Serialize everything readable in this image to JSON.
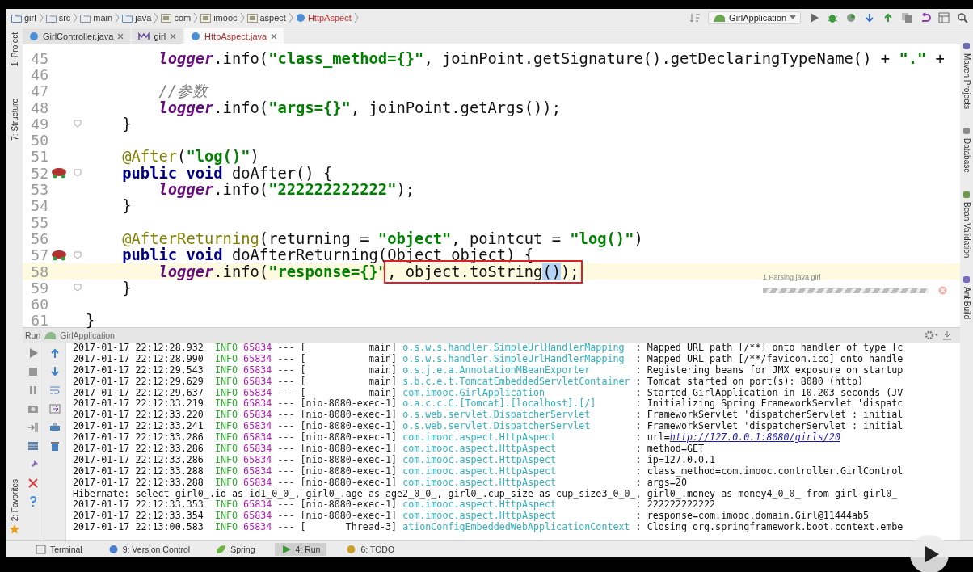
{
  "breadcrumbs": [
    {
      "label": "girl",
      "kind": "module"
    },
    {
      "label": "src",
      "kind": "folder"
    },
    {
      "label": "main",
      "kind": "folder"
    },
    {
      "label": "java",
      "kind": "source"
    },
    {
      "label": "com",
      "kind": "package"
    },
    {
      "label": "imooc",
      "kind": "package"
    },
    {
      "label": "aspect",
      "kind": "package"
    },
    {
      "label": "HttpAspect",
      "kind": "class"
    }
  ],
  "run_config": {
    "label": "GirlApplication"
  },
  "tabs": [
    {
      "label": "GirlController.java",
      "kind": "class",
      "selected": false
    },
    {
      "label": "girl",
      "kind": "maven",
      "selected": false
    },
    {
      "label": "HttpAspect.java",
      "kind": "class",
      "selected": true
    }
  ],
  "left_tools": [
    {
      "label": "1: Project"
    },
    {
      "label": "7: Structure"
    }
  ],
  "favorites": {
    "label": "2: Favorites"
  },
  "right_tools": [
    {
      "label": "Maven Projects",
      "kind": "maven"
    },
    {
      "label": "Database",
      "kind": "database"
    },
    {
      "label": "Bean Validation",
      "kind": "bean"
    },
    {
      "label": "Ant Build",
      "kind": "ant"
    }
  ],
  "editor": {
    "lines": [
      {
        "n": "45",
        "segs": [
          {
            "t": "        logger",
            "kind": "field"
          },
          {
            "t": ".info(",
            "kind": "plain"
          },
          {
            "t": "\"class_method={}\"",
            "kind": "str"
          },
          {
            "t": ", joinPoint.getSignature().getDeclaringTypeName() + ",
            "kind": "plain"
          },
          {
            "t": "\".\"",
            "kind": "str"
          },
          {
            "t": " +",
            "kind": "plain"
          }
        ]
      },
      {
        "n": "46"
      },
      {
        "n": "47",
        "segs": [
          {
            "t": "        //参数",
            "kind": "comment"
          }
        ]
      },
      {
        "n": "48",
        "segs": [
          {
            "t": "        logger",
            "kind": "field"
          },
          {
            "t": ".info(",
            "kind": "plain"
          },
          {
            "t": "\"args={}\"",
            "kind": "str"
          },
          {
            "t": ", joinPoint.getArgs());",
            "kind": "plain"
          }
        ]
      },
      {
        "n": "49",
        "fold": true,
        "segs": [
          {
            "t": "    }",
            "kind": "plain"
          }
        ]
      },
      {
        "n": "50"
      },
      {
        "n": "51",
        "segs": [
          {
            "t": "    @After",
            "kind": "ann"
          },
          {
            "t": "(",
            "kind": "plain"
          },
          {
            "t": "\"log()\"",
            "kind": "str"
          },
          {
            "t": ")",
            "kind": "plain"
          }
        ]
      },
      {
        "n": "52",
        "advice": true,
        "fold": true,
        "segs": [
          {
            "t": "    public void",
            "kind": "kw"
          },
          {
            "t": " doAfter() {",
            "kind": "plain"
          }
        ]
      },
      {
        "n": "53",
        "segs": [
          {
            "t": "        logger",
            "kind": "field"
          },
          {
            "t": ".info(",
            "kind": "plain"
          },
          {
            "t": "\"222222222222\"",
            "kind": "str"
          },
          {
            "t": ");",
            "kind": "plain"
          }
        ]
      },
      {
        "n": "54",
        "segs": [
          {
            "t": "    }",
            "kind": "plain"
          }
        ]
      },
      {
        "n": "55"
      },
      {
        "n": "56",
        "segs": [
          {
            "t": "    @AfterReturning",
            "kind": "ann"
          },
          {
            "t": "(returning = ",
            "kind": "plain"
          },
          {
            "t": "\"object\"",
            "kind": "str"
          },
          {
            "t": ", pointcut = ",
            "kind": "plain"
          },
          {
            "t": "\"log()\"",
            "kind": "str"
          },
          {
            "t": ")",
            "kind": "plain"
          }
        ]
      },
      {
        "n": "57",
        "advice": true,
        "fold": true,
        "segs": [
          {
            "t": "    public void",
            "kind": "kw"
          },
          {
            "t": " doAfterReturning(Object object) {",
            "kind": "plain"
          }
        ]
      },
      {
        "n": "58",
        "current": true,
        "segs": [
          {
            "t": "        logger",
            "kind": "field"
          },
          {
            "t": ".info(",
            "kind": "plain"
          },
          {
            "t": "\"response={}\"",
            "kind": "str"
          },
          {
            "kind": "box",
            "parts": [
              {
                "t": ", object.toString",
                "kind": "plain"
              },
              {
                "t": "()",
                "kind": "match"
              },
              {
                "t": ");",
                "kind": "plain"
              }
            ]
          }
        ]
      },
      {
        "n": "59",
        "fold": true,
        "segs": [
          {
            "t": "    }",
            "kind": "plain"
          }
        ]
      },
      {
        "n": "60"
      },
      {
        "n": "61",
        "segs": [
          {
            "t": "}",
            "kind": "plain"
          }
        ]
      }
    ]
  },
  "progress": {
    "label": "1 Parsing java girl"
  },
  "run_panel": {
    "title": "Run",
    "config": "GirlApplication",
    "rows": [
      {
        "kind": "log",
        "time": "2017-01-17 22:12:28.932",
        "level": "INFO",
        "pid": "65834",
        "sep": "---",
        "thread": "[           main]",
        "logger": "o.s.w.s.handler.SimpleUrlHandlerMapping",
        "message": ": Mapped URL path [/**] onto handler of type [c"
      },
      {
        "kind": "log",
        "time": "2017-01-17 22:12:28.990",
        "level": "INFO",
        "pid": "65834",
        "sep": "---",
        "thread": "[           main]",
        "logger": "o.s.w.s.handler.SimpleUrlHandlerMapping",
        "message": ": Mapped URL path [/**/favicon.ico] onto handle"
      },
      {
        "kind": "log",
        "time": "2017-01-17 22:12:29.543",
        "level": "INFO",
        "pid": "65834",
        "sep": "---",
        "thread": "[           main]",
        "logger": "o.s.j.e.a.AnnotationMBeanExporter",
        "message": ": Registering beans for JMX exposure on startup"
      },
      {
        "kind": "log",
        "time": "2017-01-17 22:12:29.629",
        "level": "INFO",
        "pid": "65834",
        "sep": "---",
        "thread": "[           main]",
        "logger": "s.b.c.e.t.TomcatEmbeddedServletContainer",
        "message": ": Tomcat started on port(s): 8080 (http)"
      },
      {
        "kind": "log",
        "time": "2017-01-17 22:12:29.637",
        "level": "INFO",
        "pid": "65834",
        "sep": "---",
        "thread": "[           main]",
        "logger": "com.imooc.GirlApplication",
        "message": ": Started GirlApplication in 10.203 seconds (JV"
      },
      {
        "kind": "log",
        "time": "2017-01-17 22:12:33.219",
        "level": "INFO",
        "pid": "65834",
        "sep": "---",
        "thread": "[nio-8080-exec-1]",
        "logger": "o.a.c.c.C.[Tomcat].[localhost].[/]",
        "message": ": Initializing Spring FrameworkServlet 'dispatc"
      },
      {
        "kind": "log",
        "time": "2017-01-17 22:12:33.220",
        "level": "INFO",
        "pid": "65834",
        "sep": "---",
        "thread": "[nio-8080-exec-1]",
        "logger": "o.s.web.servlet.DispatcherServlet",
        "message": ": FrameworkServlet 'dispatcherServlet': initial"
      },
      {
        "kind": "log",
        "time": "2017-01-17 22:12:33.241",
        "level": "INFO",
        "pid": "65834",
        "sep": "---",
        "thread": "[nio-8080-exec-1]",
        "logger": "o.s.web.servlet.DispatcherServlet",
        "message": ": FrameworkServlet 'dispatcherServlet': initial"
      },
      {
        "kind": "log",
        "time": "2017-01-17 22:12:33.286",
        "level": "INFO",
        "pid": "65834",
        "sep": "---",
        "thread": "[nio-8080-exec-1]",
        "logger": "com.imooc.aspect.HttpAspect",
        "message": ": url=",
        "link": "http://127.0.0.1:8080/girls/20"
      },
      {
        "kind": "log",
        "time": "2017-01-17 22:12:33.286",
        "level": "INFO",
        "pid": "65834",
        "sep": "---",
        "thread": "[nio-8080-exec-1]",
        "logger": "com.imooc.aspect.HttpAspect",
        "message": ": method=GET"
      },
      {
        "kind": "log",
        "time": "2017-01-17 22:12:33.286",
        "level": "INFO",
        "pid": "65834",
        "sep": "---",
        "thread": "[nio-8080-exec-1]",
        "logger": "com.imooc.aspect.HttpAspect",
        "message": ": ip=127.0.0.1"
      },
      {
        "kind": "log",
        "time": "2017-01-17 22:12:33.288",
        "level": "INFO",
        "pid": "65834",
        "sep": "---",
        "thread": "[nio-8080-exec-1]",
        "logger": "com.imooc.aspect.HttpAspect",
        "message": ": class_method=com.imooc.controller.GirlControl"
      },
      {
        "kind": "log",
        "time": "2017-01-17 22:12:33.288",
        "level": "INFO",
        "pid": "65834",
        "sep": "---",
        "thread": "[nio-8080-exec-1]",
        "logger": "com.imooc.aspect.HttpAspect",
        "message": ": args=20"
      },
      {
        "kind": "plain",
        "text": "Hibernate: select girl0_.id as id1_0_0_, girl0_.age as age2_0_0_, girl0_.cup_size as cup_size3_0_0_, girl0_.money as money4_0_0_ from girl girl0_"
      },
      {
        "kind": "log",
        "time": "2017-01-17 22:12:33.353",
        "level": "INFO",
        "pid": "65834",
        "sep": "---",
        "thread": "[nio-8080-exec-1]",
        "logger": "com.imooc.aspect.HttpAspect",
        "message": ": 222222222222"
      },
      {
        "kind": "log",
        "time": "2017-01-17 22:12:33.354",
        "level": "INFO",
        "pid": "65834",
        "sep": "---",
        "thread": "[nio-8080-exec-1]",
        "logger": "com.imooc.aspect.HttpAspect",
        "message": ": response=com.imooc.domain.Girl@11444ab5"
      },
      {
        "kind": "log",
        "time": "2017-01-17 22:13:00.583",
        "level": "INFO",
        "pid": "65834",
        "sep": "---",
        "thread": "[       Thread-3]",
        "logger": "ationConfigEmbeddedWebApplicationContext",
        "message": ": Closing org.springframework.boot.context.embe"
      }
    ]
  },
  "bottom_tools": [
    {
      "label": "Terminal",
      "kind": "terminal",
      "selected": false
    },
    {
      "label": "9: Version Control",
      "kind": "vcs",
      "selected": false
    },
    {
      "label": "Spring",
      "kind": "spring",
      "selected": false
    },
    {
      "label": "4: Run",
      "kind": "run",
      "selected": true
    },
    {
      "label": "6: TODO",
      "kind": "todo",
      "selected": false
    }
  ]
}
